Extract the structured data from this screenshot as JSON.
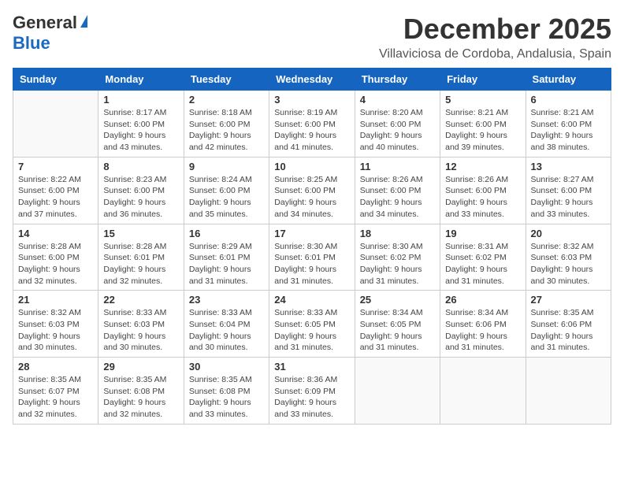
{
  "header": {
    "logo_general": "General",
    "logo_blue": "Blue",
    "month": "December 2025",
    "location": "Villaviciosa de Cordoba, Andalusia, Spain"
  },
  "weekdays": [
    "Sunday",
    "Monday",
    "Tuesday",
    "Wednesday",
    "Thursday",
    "Friday",
    "Saturday"
  ],
  "weeks": [
    [
      {
        "day": "",
        "sunrise": "",
        "sunset": "",
        "daylight": ""
      },
      {
        "day": "1",
        "sunrise": "Sunrise: 8:17 AM",
        "sunset": "Sunset: 6:00 PM",
        "daylight": "Daylight: 9 hours and 43 minutes."
      },
      {
        "day": "2",
        "sunrise": "Sunrise: 8:18 AM",
        "sunset": "Sunset: 6:00 PM",
        "daylight": "Daylight: 9 hours and 42 minutes."
      },
      {
        "day": "3",
        "sunrise": "Sunrise: 8:19 AM",
        "sunset": "Sunset: 6:00 PM",
        "daylight": "Daylight: 9 hours and 41 minutes."
      },
      {
        "day": "4",
        "sunrise": "Sunrise: 8:20 AM",
        "sunset": "Sunset: 6:00 PM",
        "daylight": "Daylight: 9 hours and 40 minutes."
      },
      {
        "day": "5",
        "sunrise": "Sunrise: 8:21 AM",
        "sunset": "Sunset: 6:00 PM",
        "daylight": "Daylight: 9 hours and 39 minutes."
      },
      {
        "day": "6",
        "sunrise": "Sunrise: 8:21 AM",
        "sunset": "Sunset: 6:00 PM",
        "daylight": "Daylight: 9 hours and 38 minutes."
      }
    ],
    [
      {
        "day": "7",
        "sunrise": "Sunrise: 8:22 AM",
        "sunset": "Sunset: 6:00 PM",
        "daylight": "Daylight: 9 hours and 37 minutes."
      },
      {
        "day": "8",
        "sunrise": "Sunrise: 8:23 AM",
        "sunset": "Sunset: 6:00 PM",
        "daylight": "Daylight: 9 hours and 36 minutes."
      },
      {
        "day": "9",
        "sunrise": "Sunrise: 8:24 AM",
        "sunset": "Sunset: 6:00 PM",
        "daylight": "Daylight: 9 hours and 35 minutes."
      },
      {
        "day": "10",
        "sunrise": "Sunrise: 8:25 AM",
        "sunset": "Sunset: 6:00 PM",
        "daylight": "Daylight: 9 hours and 34 minutes."
      },
      {
        "day": "11",
        "sunrise": "Sunrise: 8:26 AM",
        "sunset": "Sunset: 6:00 PM",
        "daylight": "Daylight: 9 hours and 34 minutes."
      },
      {
        "day": "12",
        "sunrise": "Sunrise: 8:26 AM",
        "sunset": "Sunset: 6:00 PM",
        "daylight": "Daylight: 9 hours and 33 minutes."
      },
      {
        "day": "13",
        "sunrise": "Sunrise: 8:27 AM",
        "sunset": "Sunset: 6:00 PM",
        "daylight": "Daylight: 9 hours and 33 minutes."
      }
    ],
    [
      {
        "day": "14",
        "sunrise": "Sunrise: 8:28 AM",
        "sunset": "Sunset: 6:00 PM",
        "daylight": "Daylight: 9 hours and 32 minutes."
      },
      {
        "day": "15",
        "sunrise": "Sunrise: 8:28 AM",
        "sunset": "Sunset: 6:01 PM",
        "daylight": "Daylight: 9 hours and 32 minutes."
      },
      {
        "day": "16",
        "sunrise": "Sunrise: 8:29 AM",
        "sunset": "Sunset: 6:01 PM",
        "daylight": "Daylight: 9 hours and 31 minutes."
      },
      {
        "day": "17",
        "sunrise": "Sunrise: 8:30 AM",
        "sunset": "Sunset: 6:01 PM",
        "daylight": "Daylight: 9 hours and 31 minutes."
      },
      {
        "day": "18",
        "sunrise": "Sunrise: 8:30 AM",
        "sunset": "Sunset: 6:02 PM",
        "daylight": "Daylight: 9 hours and 31 minutes."
      },
      {
        "day": "19",
        "sunrise": "Sunrise: 8:31 AM",
        "sunset": "Sunset: 6:02 PM",
        "daylight": "Daylight: 9 hours and 31 minutes."
      },
      {
        "day": "20",
        "sunrise": "Sunrise: 8:32 AM",
        "sunset": "Sunset: 6:03 PM",
        "daylight": "Daylight: 9 hours and 30 minutes."
      }
    ],
    [
      {
        "day": "21",
        "sunrise": "Sunrise: 8:32 AM",
        "sunset": "Sunset: 6:03 PM",
        "daylight": "Daylight: 9 hours and 30 minutes."
      },
      {
        "day": "22",
        "sunrise": "Sunrise: 8:33 AM",
        "sunset": "Sunset: 6:03 PM",
        "daylight": "Daylight: 9 hours and 30 minutes."
      },
      {
        "day": "23",
        "sunrise": "Sunrise: 8:33 AM",
        "sunset": "Sunset: 6:04 PM",
        "daylight": "Daylight: 9 hours and 30 minutes."
      },
      {
        "day": "24",
        "sunrise": "Sunrise: 8:33 AM",
        "sunset": "Sunset: 6:05 PM",
        "daylight": "Daylight: 9 hours and 31 minutes."
      },
      {
        "day": "25",
        "sunrise": "Sunrise: 8:34 AM",
        "sunset": "Sunset: 6:05 PM",
        "daylight": "Daylight: 9 hours and 31 minutes."
      },
      {
        "day": "26",
        "sunrise": "Sunrise: 8:34 AM",
        "sunset": "Sunset: 6:06 PM",
        "daylight": "Daylight: 9 hours and 31 minutes."
      },
      {
        "day": "27",
        "sunrise": "Sunrise: 8:35 AM",
        "sunset": "Sunset: 6:06 PM",
        "daylight": "Daylight: 9 hours and 31 minutes."
      }
    ],
    [
      {
        "day": "28",
        "sunrise": "Sunrise: 8:35 AM",
        "sunset": "Sunset: 6:07 PM",
        "daylight": "Daylight: 9 hours and 32 minutes."
      },
      {
        "day": "29",
        "sunrise": "Sunrise: 8:35 AM",
        "sunset": "Sunset: 6:08 PM",
        "daylight": "Daylight: 9 hours and 32 minutes."
      },
      {
        "day": "30",
        "sunrise": "Sunrise: 8:35 AM",
        "sunset": "Sunset: 6:08 PM",
        "daylight": "Daylight: 9 hours and 33 minutes."
      },
      {
        "day": "31",
        "sunrise": "Sunrise: 8:36 AM",
        "sunset": "Sunset: 6:09 PM",
        "daylight": "Daylight: 9 hours and 33 minutes."
      },
      {
        "day": "",
        "sunrise": "",
        "sunset": "",
        "daylight": ""
      },
      {
        "day": "",
        "sunrise": "",
        "sunset": "",
        "daylight": ""
      },
      {
        "day": "",
        "sunrise": "",
        "sunset": "",
        "daylight": ""
      }
    ]
  ]
}
